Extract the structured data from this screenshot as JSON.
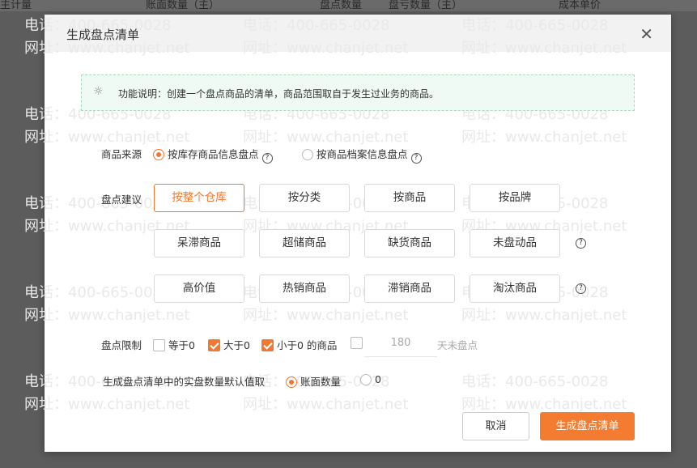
{
  "background_table": {
    "columns": [
      "主计量",
      "账面数量（主）",
      "盘点数量",
      "盘亏数量（主）",
      "成本单价"
    ]
  },
  "watermark": {
    "phone": "电话：400-665-0028",
    "site": "网址：www.chanjet.net"
  },
  "modal": {
    "title": "生成盘点清单",
    "close_icon": "close-icon",
    "tip": "功能说明：创建一个盘点商品的清单，商品范围取自于发生过业务的商品。",
    "source": {
      "label": "商品来源",
      "options": [
        {
          "label": "按库存商品信息盘点",
          "selected": true
        },
        {
          "label": "按商品档案信息盘点",
          "selected": false
        }
      ]
    },
    "suggest": {
      "label": "盘点建议",
      "rows": [
        [
          "按整个仓库",
          "按分类",
          "按商品",
          "按品牌"
        ],
        [
          "呆滞商品",
          "超储商品",
          "缺货商品",
          "未盘动品"
        ],
        [
          "高价值",
          "热销商品",
          "滞销商品",
          "淘汰商品"
        ]
      ],
      "active": "按整个仓库"
    },
    "limit": {
      "label": "盘点限制",
      "options": [
        {
          "label": "等于0",
          "checked": false
        },
        {
          "label": "大于0",
          "checked": true
        },
        {
          "label": "小于0 的商品",
          "checked": true
        }
      ],
      "days_checked": false,
      "days_value": "180",
      "days_suffix": "天未盘点"
    },
    "default_qty": {
      "label": "生成盘点清单中的实盘数量默认值取",
      "options": [
        {
          "label": "账面数量",
          "selected": true
        },
        {
          "label": "0",
          "selected": false
        }
      ]
    },
    "cancel": "取消",
    "confirm": "生成盘点清单",
    "accent": "#f07830"
  }
}
